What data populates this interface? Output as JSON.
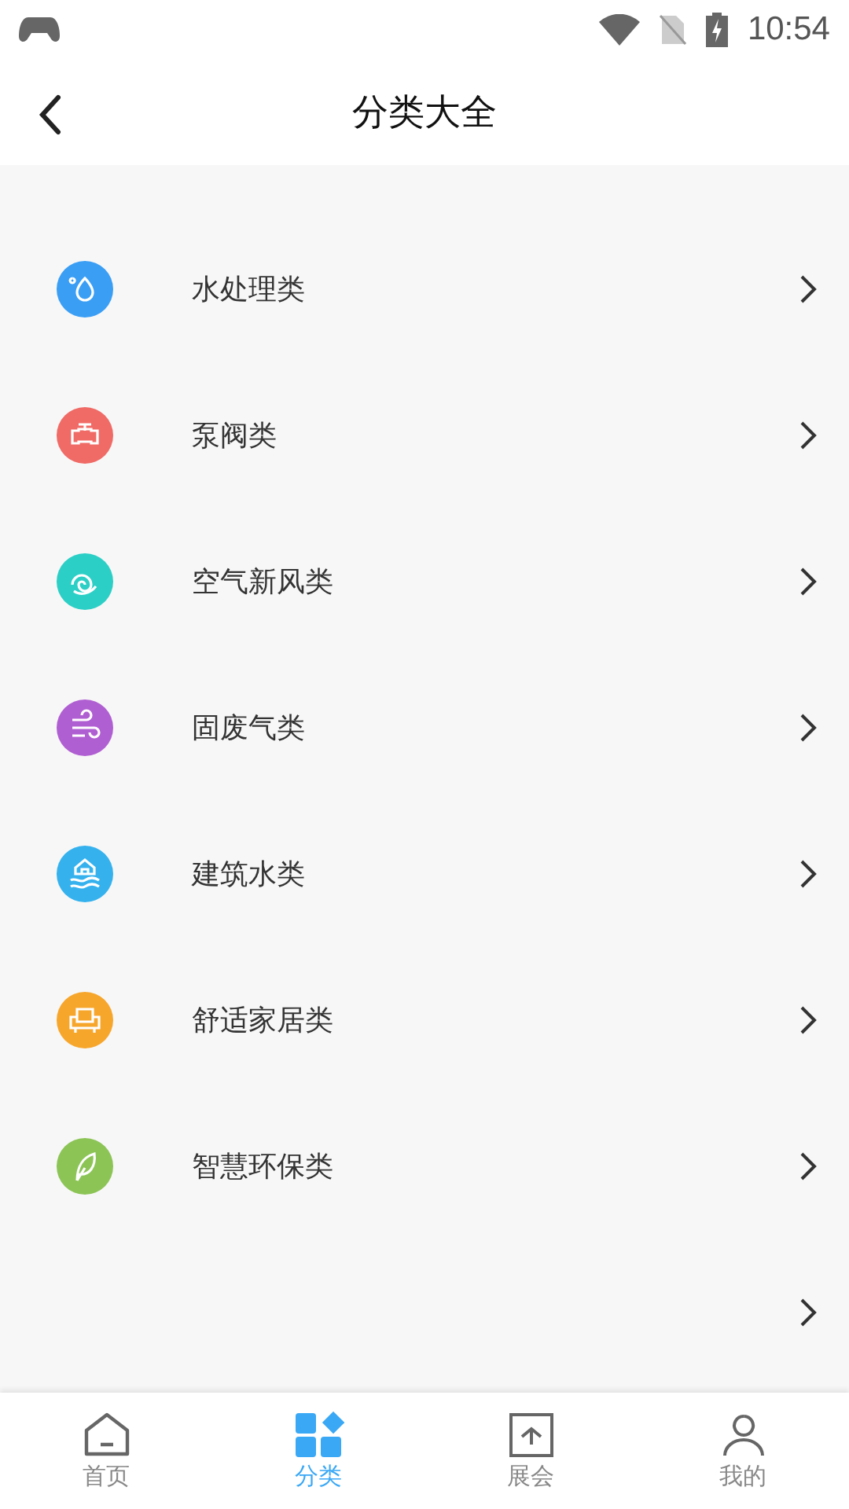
{
  "status_bar": {
    "time": "10:54"
  },
  "header": {
    "title": "分类大全"
  },
  "categories": [
    {
      "kind": "category",
      "label": "水处理类",
      "color": "#3a9ef5"
    },
    {
      "kind": "category",
      "label": "泵阀类",
      "color": "#f06a66"
    },
    {
      "kind": "category",
      "label": "空气新风类",
      "color": "#2ccfc6"
    },
    {
      "kind": "category",
      "label": "固废气类",
      "color": "#b05fd2"
    },
    {
      "kind": "category",
      "label": "建筑水类",
      "color": "#35b2ee"
    },
    {
      "kind": "category",
      "label": "舒适家居类",
      "color": "#f7a62c"
    },
    {
      "kind": "category",
      "label": "智慧环保类",
      "color": "#8cc456"
    },
    {
      "kind": "empty"
    }
  ],
  "tab_bar": [
    {
      "label": "首页",
      "selected": false
    },
    {
      "label": "分类",
      "selected": true
    },
    {
      "label": "展会",
      "selected": false
    },
    {
      "label": "我的",
      "selected": false
    }
  ]
}
